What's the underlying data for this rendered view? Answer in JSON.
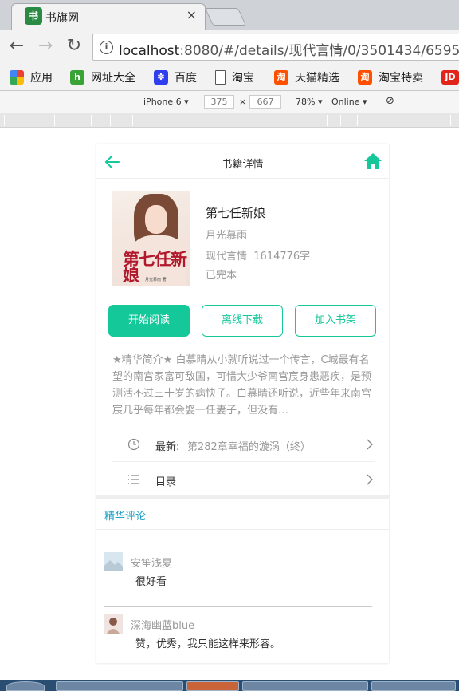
{
  "browser": {
    "tab_title": "书旗网",
    "tab_favicon_text": "书",
    "tab_close": "×",
    "url_host": "localhost",
    "url_rest": ":8080/#/details/现代言情/0/3501434/6595",
    "bookmarks": [
      {
        "label": "应用",
        "icon": "apps-grid-icon",
        "color": "#e94235"
      },
      {
        "label": "网址大全",
        "icon": "hao-icon",
        "color": "#3aa335"
      },
      {
        "label": "百度",
        "icon": "baidu-paw-icon",
        "color": "#2f3ff0"
      },
      {
        "label": "淘宝",
        "icon": "page-icon",
        "color": "#ffffff"
      },
      {
        "label": "天猫精选",
        "icon": "taobao-icon",
        "color": "#ff5000"
      },
      {
        "label": "淘宝特卖",
        "icon": "taobao-icon",
        "color": "#ff5000"
      },
      {
        "label": "JD",
        "icon": "jd-icon",
        "color": "#e1251b"
      }
    ]
  },
  "devtools": {
    "device": "iPhone 6",
    "width": "375",
    "times": "×",
    "height": "667",
    "zoom": "78%",
    "network": "Online"
  },
  "page": {
    "header_title": "书籍详情",
    "book": {
      "title": "第七任新娘",
      "author": "月光慕雨",
      "category": "现代言情",
      "word_count": "1614776字",
      "status": "已完本",
      "cover_text": "第七任新娘",
      "cover_author": "月光慕雨 著"
    },
    "buttons": {
      "read": "开始阅读",
      "download": "离线下载",
      "shelf": "加入书架"
    },
    "intro": "★精华简介★ 白慕晴从小就听说过一个传言，C城最有名望的南宫家富可敌国，可惜大少爷南宫宸身患恶疾，是预测活不过三十岁的病快子。白慕晴还听说，近些年来南宫宸几乎每年都会娶一任妻子，但没有…",
    "latest_label": "最新:",
    "latest_chapter": "第282章幸福的漩涡（终）",
    "catalog_label": "目录",
    "comments_title": "精华评论",
    "comments": [
      {
        "user": "安笙浅夏",
        "text": "很好看"
      },
      {
        "user": "深海幽蓝blue",
        "text": "赞，优秀，我只能这样来形容。"
      }
    ]
  },
  "colors": {
    "accent": "#14c89a",
    "section_title": "#21a1c4"
  }
}
